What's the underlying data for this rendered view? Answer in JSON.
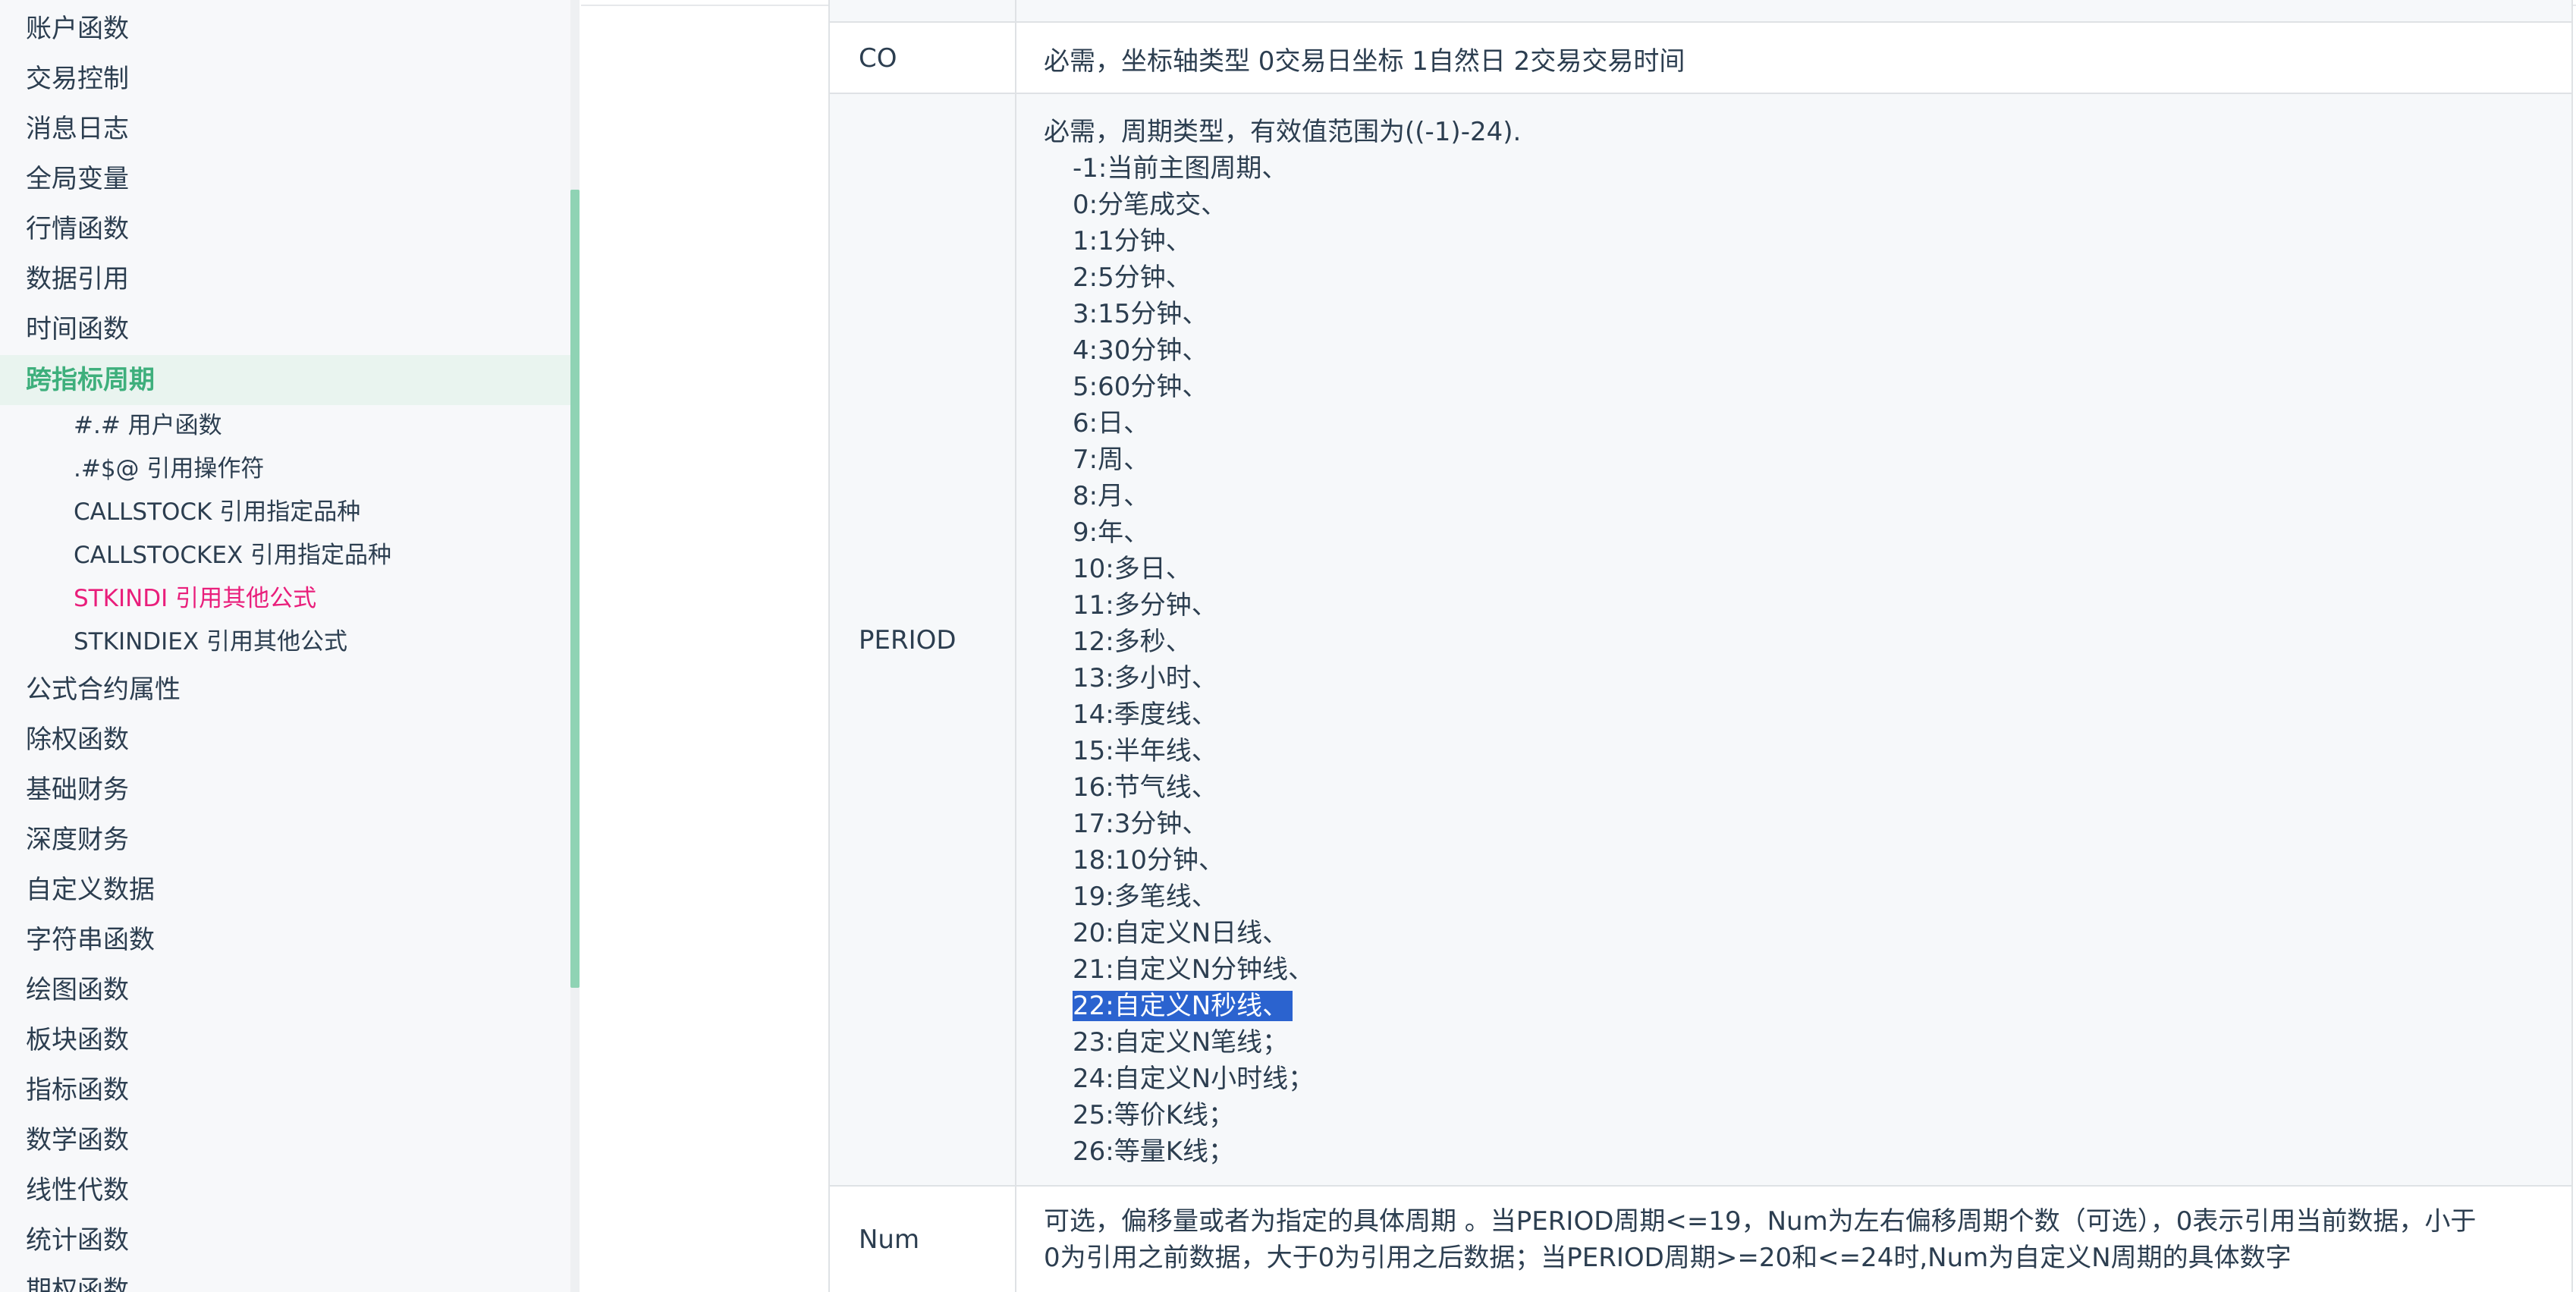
{
  "sidebar": {
    "items_top": [
      {
        "label": "账户函数"
      },
      {
        "label": "交易控制"
      },
      {
        "label": "消息日志"
      },
      {
        "label": "全局变量"
      },
      {
        "label": "行情函数"
      },
      {
        "label": "数据引用"
      },
      {
        "label": "时间函数"
      }
    ],
    "active_item": {
      "label": "跨指标周期"
    },
    "sub_items": [
      {
        "label": "#.# 用户函数"
      },
      {
        "label": ".#$@ 引用操作符"
      },
      {
        "label": "CALLSTOCK 引用指定品种"
      },
      {
        "label": "CALLSTOCKEX 引用指定品种"
      },
      {
        "label": "STKINDI 引用其他公式",
        "current": true
      },
      {
        "label": "STKINDIEX 引用其他公式"
      }
    ],
    "items_bottom": [
      {
        "label": "公式合约属性"
      },
      {
        "label": "除权函数"
      },
      {
        "label": "基础财务"
      },
      {
        "label": "深度财务"
      },
      {
        "label": "自定义数据"
      },
      {
        "label": "字符串函数"
      },
      {
        "label": "绘图函数"
      },
      {
        "label": "板块函数"
      },
      {
        "label": "指标函数"
      },
      {
        "label": "数学函数"
      },
      {
        "label": "线性代数"
      },
      {
        "label": "统计函数"
      },
      {
        "label": "期权函数"
      }
    ]
  },
  "table": {
    "co": {
      "name": "CO",
      "desc": "必需，坐标轴类型 0交易日坐标 1自然日 2交易交易时间"
    },
    "period": {
      "name": "PERIOD",
      "desc_head": "必需，周期类型，有效值范围为((-1)-24).",
      "options": [
        "-1:当前主图周期、",
        "0:分笔成交、",
        "1:1分钟、",
        "2:5分钟、",
        "3:15分钟、",
        "4:30分钟、",
        "5:60分钟、",
        "6:日、",
        "7:周、",
        "8:月、",
        "9:年、",
        "10:多日、",
        "11:多分钟、",
        "12:多秒、",
        "13:多小时、",
        "14:季度线、",
        "15:半年线、",
        "16:节气线、",
        "17:3分钟、",
        "18:10分钟、",
        "19:多笔线、",
        "20:自定义N日线、",
        "21:自定义N分钟线、",
        "22:自定义N秒线、",
        "23:自定义N笔线；",
        "24:自定义N小时线；",
        "25:等价K线；",
        "26:等量K线；"
      ],
      "selected_option": "22:自定义N秒线、"
    },
    "num": {
      "name": "Num",
      "desc_line1": "可选，偏移量或者为指定的具体周期 。当PERIOD周期<=19，Num为左右偏移周期个数（可选），0表示引用当前数据，小于",
      "desc_line2": "0为引用之前数据，大于0为引用之后数据；当PERIOD周期>=20和<=24时,Num为自定义N周期的具体数字"
    }
  }
}
